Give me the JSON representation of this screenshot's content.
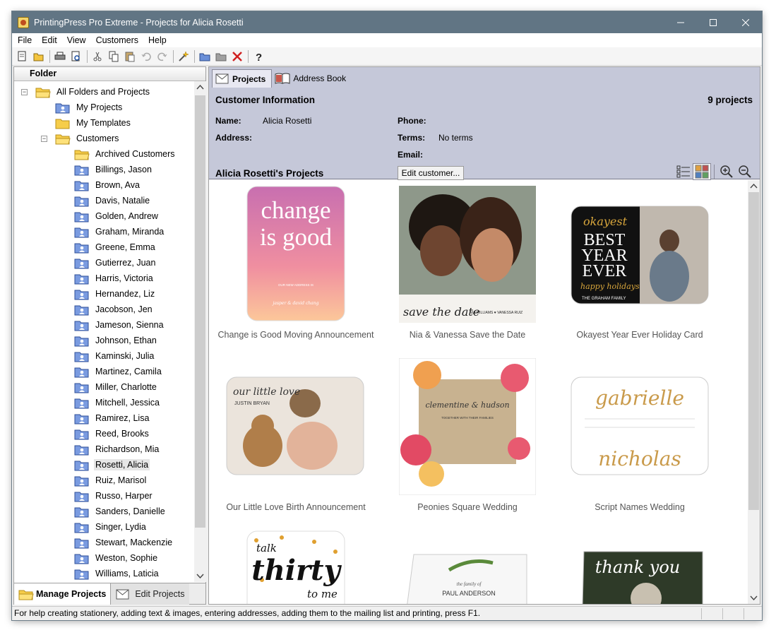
{
  "window": {
    "title": "PrintingPress Pro Extreme - Projects for Alicia Rosetti"
  },
  "menu": [
    "File",
    "Edit",
    "View",
    "Customers",
    "Help"
  ],
  "folder_panel": {
    "header": "Folder",
    "root": "All Folders and Projects",
    "my_projects": "My Projects",
    "my_templates": "My Templates",
    "customers": "Customers",
    "archived": "Archived Customers",
    "customer_list": [
      "Billings, Jason",
      "Brown, Ava",
      "Davis, Natalie",
      "Golden, Andrew",
      "Graham, Miranda",
      "Greene, Emma",
      "Gutierrez, Juan",
      "Harris, Victoria",
      "Hernandez, Liz",
      "Jacobson, Jen",
      "Jameson, Sienna",
      "Johnson, Ethan",
      "Kaminski, Julia",
      "Martinez, Camila",
      "Miller, Charlotte",
      "Mitchell, Jessica",
      "Ramirez, Lisa",
      "Reed, Brooks",
      "Richardson, Mia",
      "Rosetti, Alicia",
      "Ruiz, Marisol",
      "Russo, Harper",
      "Sanders, Danielle",
      "Singer, Lydia",
      "Stewart, Mackenzie",
      "Weston, Sophie",
      "Williams, Laticia"
    ],
    "selected_customer": "Rosetti, Alicia"
  },
  "bottom_tabs": {
    "manage": "Manage Projects",
    "edit": "Edit Projects"
  },
  "tabs": {
    "projects": "Projects",
    "address_book": "Address Book"
  },
  "customer_info": {
    "title": "Customer Information",
    "count": "9 projects",
    "name_label": "Name:",
    "name_value": "Alicia Rosetti",
    "address_label": "Address:",
    "phone_label": "Phone:",
    "terms_label": "Terms:",
    "terms_value": "No terms",
    "email_label": "Email:",
    "projects_title": "Alicia Rosetti's Projects",
    "edit_button": "Edit customer..."
  },
  "projects": [
    {
      "caption": "Change is Good Moving Announcement",
      "art_big": "change is good",
      "art_small": "OUR NEW ADDRESS IS",
      "art_sig": "jasper & david chang"
    },
    {
      "caption": "Nia & Vanessa Save the Date",
      "art_big": "save the date",
      "art_small": "NIA WILLIAMS ♥ VANESSA RUIZ"
    },
    {
      "caption": "Okayest Year Ever Holiday Card",
      "art_top": "okayest",
      "art_big": "BEST YEAR EVER",
      "art_script": "happy holidays",
      "art_small": "THE GRAHAM FAMILY"
    },
    {
      "caption": "Our Little Love Birth Announcement",
      "art_top": "our little love",
      "art_small": "JUSTIN BRYAN"
    },
    {
      "caption": "Peonies Square Wedding",
      "art_big": "clementine & hudson",
      "art_small": "TOGETHER WITH THEIR FAMILIES"
    },
    {
      "caption": "Script Names Wedding",
      "art_big": "gabrielle",
      "art_big2": "nicholas"
    },
    {
      "caption": "",
      "art_big": "talk thirty to me"
    },
    {
      "caption": "",
      "art_small": "the family of",
      "art_big": "PAUL ANDERSON"
    },
    {
      "caption": "",
      "art_big": "thank you"
    }
  ],
  "status": "For help creating stationery, adding text & images, entering addresses, adding them to the mailing list and printing, press F1."
}
